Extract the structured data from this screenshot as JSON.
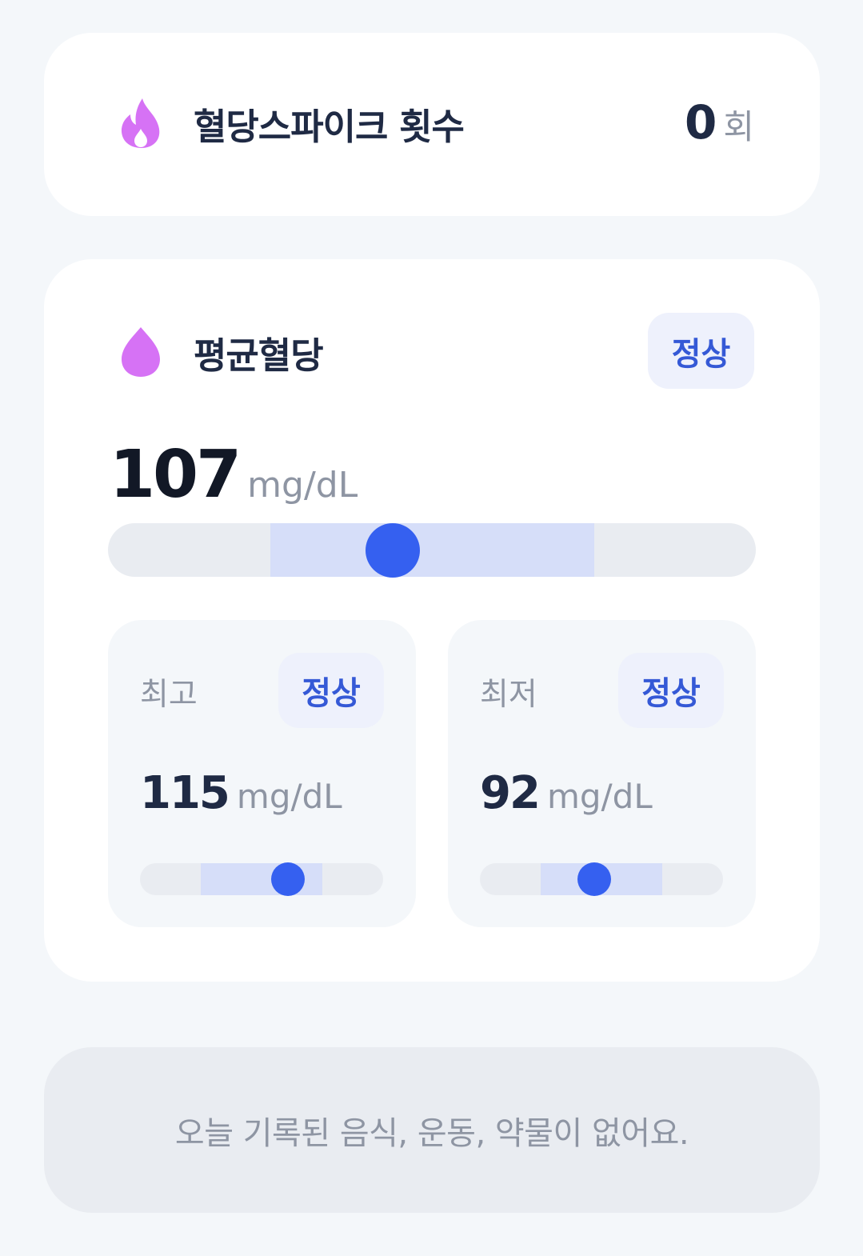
{
  "spike": {
    "title": "혈당스파이크 횟수",
    "count": "0",
    "unit": "회",
    "icon": "flame-icon",
    "icon_color": "#d672f5"
  },
  "average": {
    "title": "평균혈당",
    "icon": "drop-icon",
    "icon_color": "#d672f5",
    "badge": "정상",
    "value": "107",
    "unit": "mg/dL",
    "gauge": {
      "range_start": 0.25,
      "range_end": 0.75,
      "position": 0.44
    }
  },
  "max": {
    "label": "최고",
    "badge": "정상",
    "value": "115",
    "unit": "mg/dL",
    "gauge": {
      "range_start": 0.25,
      "range_end": 0.75,
      "position": 0.61
    }
  },
  "min": {
    "label": "최저",
    "badge": "정상",
    "value": "92",
    "unit": "mg/dL",
    "gauge": {
      "range_start": 0.25,
      "range_end": 0.75,
      "position": 0.47
    }
  },
  "note": {
    "text": "오늘 기록된 음식, 운동, 약물이 없어요."
  },
  "colors": {
    "accent": "#3560f0",
    "badge_bg": "#eef1fc",
    "badge_text": "#3559d6",
    "range_fill": "#d6def9"
  }
}
